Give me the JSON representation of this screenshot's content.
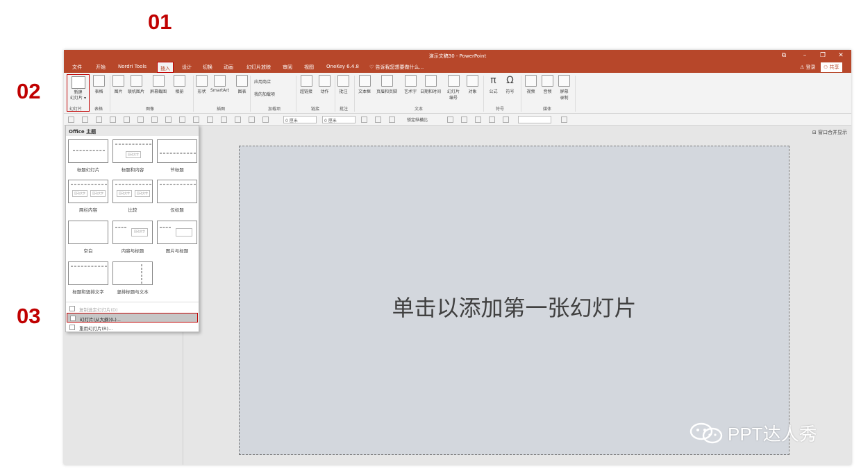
{
  "annotations": {
    "step1": "01",
    "step2": "02",
    "step3": "03"
  },
  "window": {
    "title": "演示文稿30 - PowerPoint",
    "signin": "⚠ 登录",
    "share": "⚇ 共享",
    "controls": [
      "⧉",
      "–",
      "❐",
      "✕"
    ]
  },
  "menu": {
    "tabs": [
      "文件",
      "开始",
      "Nordri Tools",
      "插入",
      "设计",
      "切换",
      "动画",
      "幻灯片放映",
      "审阅",
      "视图",
      "OneKey 6.4.8"
    ],
    "active_tab": "插入",
    "tell_me": "♡ 告诉我您想要做什么..."
  },
  "ribbon": {
    "new_slide": "新建\n幻灯片 ▾",
    "buttons": [
      {
        "label": "表格"
      },
      {
        "label": "图片"
      },
      {
        "label": "联机图片"
      },
      {
        "label": "屏幕截图"
      },
      {
        "label": "相册"
      },
      {
        "label": "形状"
      },
      {
        "label": "SmartArt"
      },
      {
        "label": "图表"
      },
      {
        "label": "应用商店"
      },
      {
        "label": "我的加载项"
      },
      {
        "label": "超链接"
      },
      {
        "label": "动作"
      },
      {
        "label": "批注"
      },
      {
        "label": "文本框"
      },
      {
        "label": "页眉和页脚"
      },
      {
        "label": "艺术字"
      },
      {
        "label": "日期和时间"
      },
      {
        "label": "幻灯片\n编号"
      },
      {
        "label": "对象"
      },
      {
        "label": "公式"
      },
      {
        "label": "符号"
      },
      {
        "label": "视频"
      },
      {
        "label": "音频"
      },
      {
        "label": "屏幕\n录制"
      }
    ],
    "groups": [
      "幻灯片",
      "表格",
      "图像",
      "插图",
      "加载项",
      "链接",
      "批注",
      "文本",
      "符号",
      "媒体"
    ]
  },
  "format_bar": {
    "width_value": "0 厘米",
    "height_value": "0 厘米",
    "lock_ratio": "锁定纵横比"
  },
  "panel": {
    "merge_window": "⊟ 窗口合并显示"
  },
  "slide": {
    "placeholder": "单击以添加第一张幻灯片"
  },
  "dropdown": {
    "header": "Office 主题",
    "layouts": [
      {
        "label": "标题幻灯片",
        "thumb": "title"
      },
      {
        "label": "标题和内容",
        "thumb": "content"
      },
      {
        "label": "节标题",
        "thumb": "section"
      },
      {
        "label": "两栏内容",
        "thumb": "twocol"
      },
      {
        "label": "比较",
        "thumb": "compare"
      },
      {
        "label": "仅标题",
        "thumb": "titleonly"
      },
      {
        "label": "空白",
        "thumb": "blank"
      },
      {
        "label": "内容与标题",
        "thumb": "contentcap"
      },
      {
        "label": "图片与标题",
        "thumb": "picturecap"
      },
      {
        "label": "标题和竖排文字",
        "thumb": "vtext"
      },
      {
        "label": "竖排标题与文本",
        "thumb": "vtitle"
      }
    ],
    "thumb_text": "回动文字",
    "items": [
      {
        "label": "复制选定幻灯片(D)",
        "state": "disabled"
      },
      {
        "label": "幻灯片(从大纲)(L)...",
        "state": "highlighted"
      },
      {
        "label": "重用幻灯片(R)...",
        "state": "normal"
      }
    ]
  },
  "watermark": {
    "text": "PPT达人秀",
    "icon": "wechat-icon"
  }
}
